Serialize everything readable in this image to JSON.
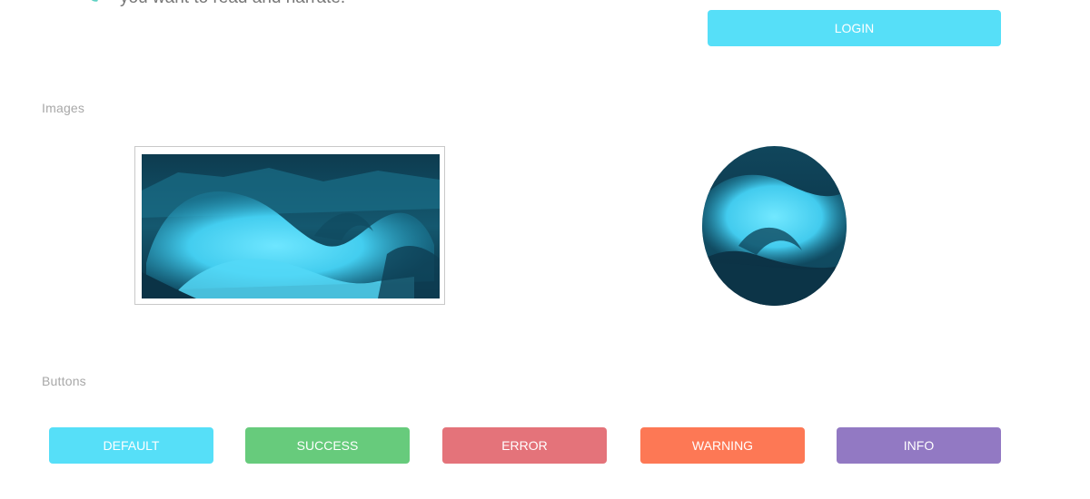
{
  "header": {
    "partial_text": "you want to read and narrate.",
    "login_label": "LOGIN"
  },
  "sections": {
    "images_label": "Images",
    "buttons_label": "Buttons"
  },
  "images": {
    "framed_alt": "ocean wave",
    "round_alt": "ocean wave"
  },
  "buttons": [
    {
      "label": "DEFAULT",
      "color": "#56dff8"
    },
    {
      "label": "SUCCESS",
      "color": "#67cb7c"
    },
    {
      "label": "ERROR",
      "color": "#e4737a"
    },
    {
      "label": "WARNING",
      "color": "#fd7855"
    },
    {
      "label": "INFO",
      "color": "#9279c3"
    }
  ],
  "colors": {
    "accent": "#56dff8",
    "section_label": "#a8a8a8",
    "quote_mark": "#5fd1c3"
  }
}
